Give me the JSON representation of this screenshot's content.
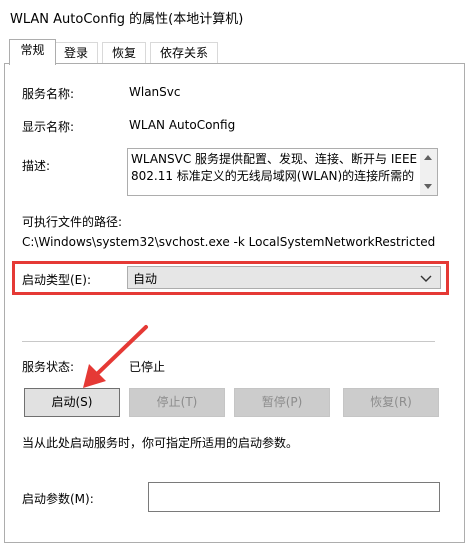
{
  "window": {
    "title": "WLAN AutoConfig 的属性(本地计算机)"
  },
  "tabs": [
    {
      "label": "常规"
    },
    {
      "label": "登录"
    },
    {
      "label": "恢复"
    },
    {
      "label": "依存关系"
    }
  ],
  "general": {
    "service_name_label": "服务名称:",
    "service_name_value": "WlanSvc",
    "display_name_label": "显示名称:",
    "display_name_value": "WLAN AutoConfig",
    "description_label": "描述:",
    "description_text": "WLANSVC 服务提供配置、发现、连接、断开与 IEEE 802.11 标准定义的无线局域网(WLAN)的连接所需的",
    "exe_path_label": "可执行文件的路径:",
    "exe_path_value": "C:\\Windows\\system32\\svchost.exe -k LocalSystemNetworkRestricted",
    "startup_type_label": "启动类型(E):",
    "startup_type_value": "自动",
    "service_status_label": "服务状态:",
    "service_status_value": "已停止",
    "buttons": {
      "start": "启动(S)",
      "stop": "停止(T)",
      "pause": "暂停(P)",
      "resume": "恢复(R)"
    },
    "hint_text": "当从此处启动服务时，你可指定所适用的启动参数。",
    "start_params_label": "启动参数(M):",
    "start_params_value": ""
  },
  "colors": {
    "highlight": "#e53935"
  },
  "icons": {
    "dropdown": "chevron-down-icon",
    "scroll_up": "scroll-up-icon",
    "scroll_down": "scroll-down-icon"
  }
}
